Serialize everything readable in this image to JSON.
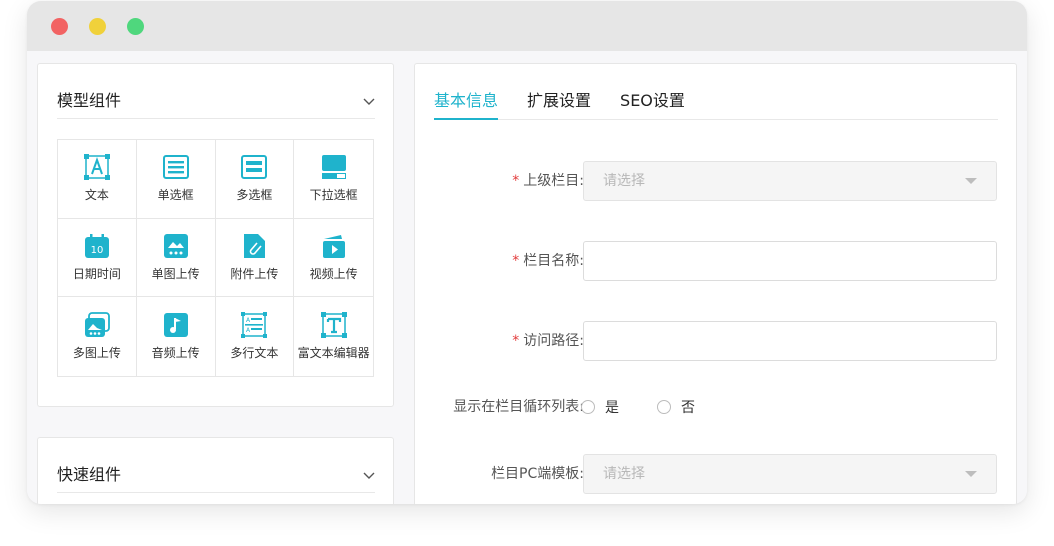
{
  "accent_color": "#1fb3cc",
  "left_panel": {
    "title": "模型组件",
    "components": [
      {
        "label": "文本",
        "icon": "text-icon"
      },
      {
        "label": "单选框",
        "icon": "radio-icon"
      },
      {
        "label": "多选框",
        "icon": "checkbox-icon"
      },
      {
        "label": "下拉选框",
        "icon": "dropdown-icon"
      },
      {
        "label": "日期时间",
        "icon": "calendar-icon"
      },
      {
        "label": "单图上传",
        "icon": "image-icon"
      },
      {
        "label": "附件上传",
        "icon": "attachment-icon"
      },
      {
        "label": "视频上传",
        "icon": "video-icon"
      },
      {
        "label": "多图上传",
        "icon": "images-icon"
      },
      {
        "label": "音频上传",
        "icon": "audio-icon"
      },
      {
        "label": "多行文本",
        "icon": "textarea-icon"
      },
      {
        "label": "富文本编辑器",
        "icon": "richtext-icon"
      }
    ]
  },
  "quick_panel": {
    "title": "快速组件"
  },
  "tabs": [
    "基本信息",
    "扩展设置",
    "SEO设置"
  ],
  "form": {
    "parent_column": {
      "label": "上级栏目:",
      "placeholder": "请选择",
      "required": "*"
    },
    "column_name": {
      "label": "栏目名称:",
      "value": "",
      "required": "*"
    },
    "access_path": {
      "label": "访问路径:",
      "value": "",
      "required": "*"
    },
    "show_in_list": {
      "label": "显示在栏目循环列表:",
      "options": [
        "是",
        "否"
      ]
    },
    "pc_template": {
      "label": "栏目PC端模板:",
      "placeholder": "请选择"
    }
  }
}
